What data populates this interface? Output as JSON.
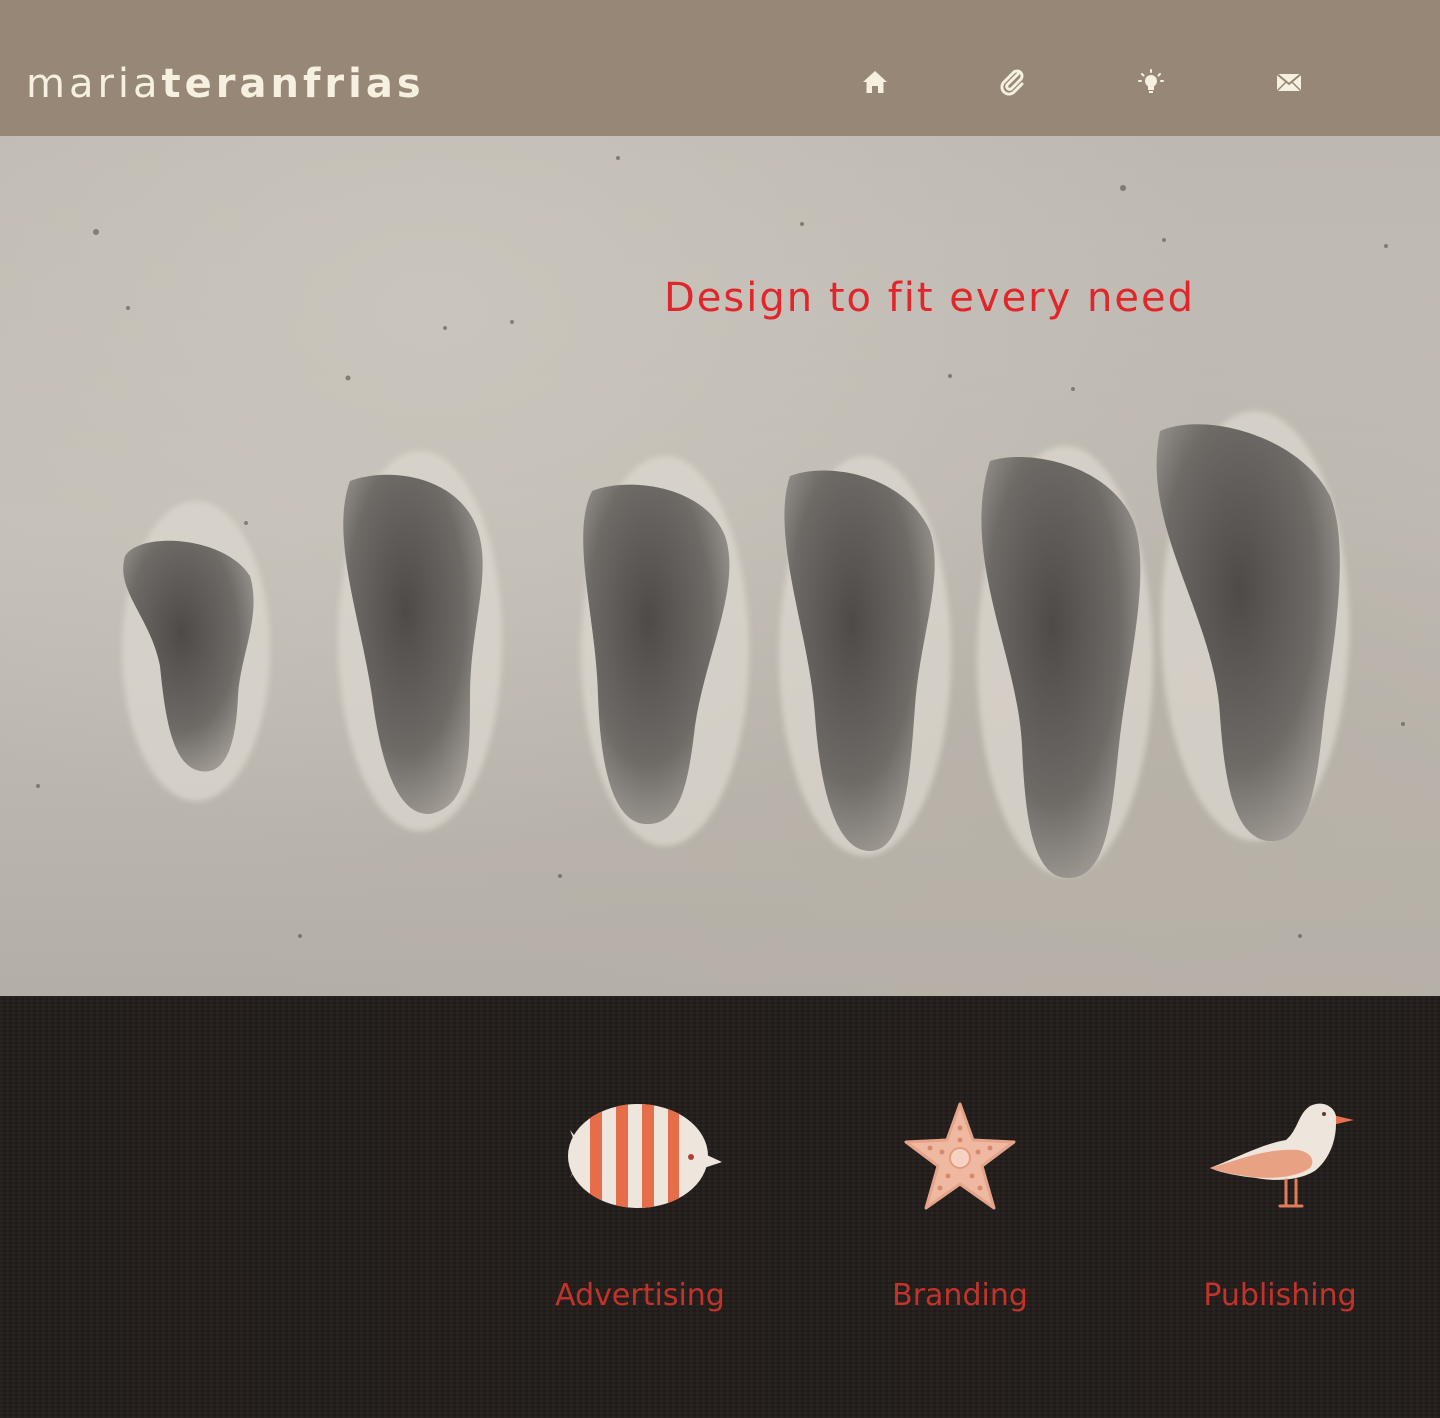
{
  "header": {
    "logo_light": "maria",
    "logo_bold": "teranfrias",
    "nav": [
      {
        "name": "home-icon"
      },
      {
        "name": "paperclip-icon"
      },
      {
        "name": "lightbulb-icon"
      },
      {
        "name": "envelope-icon"
      }
    ]
  },
  "hero": {
    "tagline": "Design to fit every need"
  },
  "services": [
    {
      "label": "Advertising",
      "icon": "fish-icon"
    },
    {
      "label": "Branding",
      "icon": "starfish-icon"
    },
    {
      "label": "Publishing",
      "icon": "seagull-icon"
    }
  ],
  "colors": {
    "header_bg": "#978776",
    "logo": "#f5f0df",
    "tagline": "#e1262b",
    "service_label": "#c2332b",
    "services_bg": "#221d1a"
  }
}
